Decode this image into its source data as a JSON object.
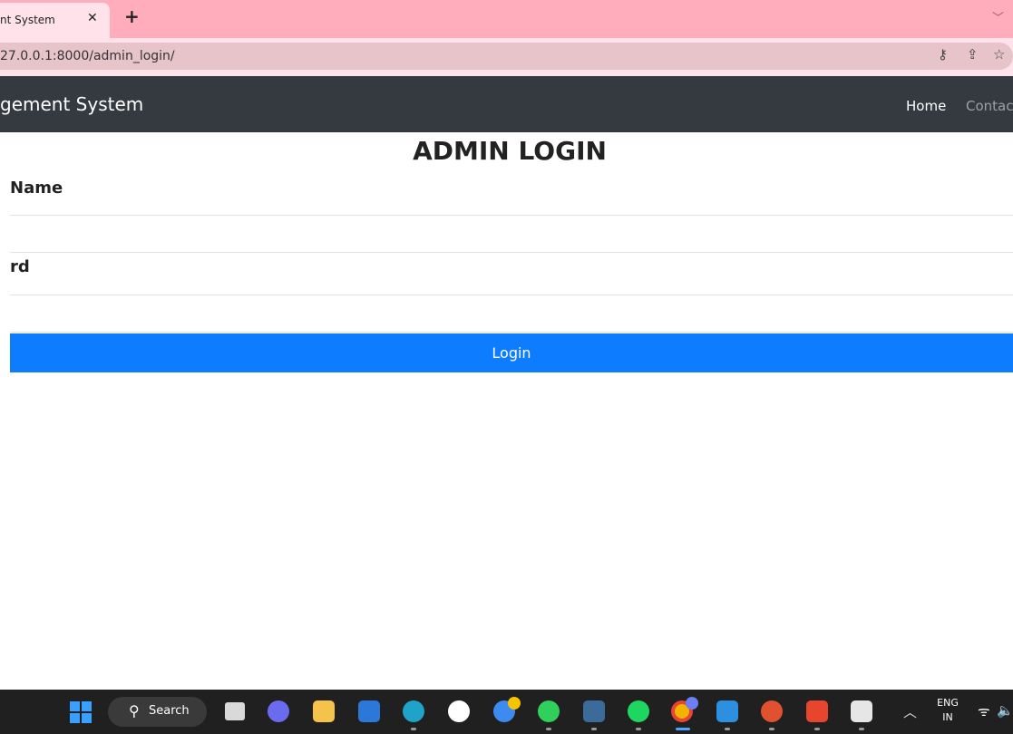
{
  "browser": {
    "tab_title": "nt System",
    "tab_close": "✕",
    "new_tab": "+",
    "tab_menu": "﹀",
    "url": "27.0.0.1:8000/admin_login/",
    "key_icon": "⚷",
    "share_icon": "⇪",
    "star_icon": "☆"
  },
  "navbar": {
    "brand": "gement System",
    "links": [
      "Home",
      "Contac"
    ]
  },
  "form": {
    "title": "ADMIN LOGIN",
    "username_label": "Name",
    "password_label": "rd",
    "submit_label": "Login"
  },
  "taskbar": {
    "search_label": "Search",
    "search_icon": "⚲",
    "lang_top": "ENG",
    "lang_bottom": "IN",
    "tray_chevron": "︿",
    "wifi_icon": "ᯤ",
    "volume_icon": "🔈"
  }
}
